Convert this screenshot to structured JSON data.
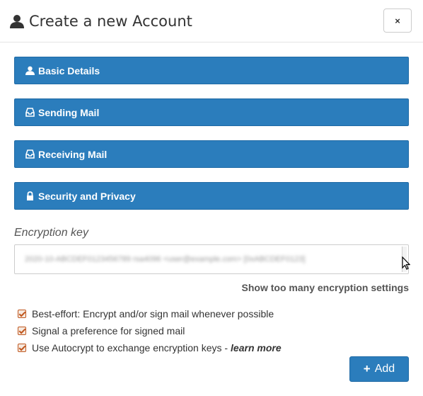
{
  "dialog": {
    "title": "Create a new Account",
    "close_label": "×"
  },
  "panels": [
    {
      "label": "Basic Details",
      "icon": "user-icon"
    },
    {
      "label": "Sending Mail",
      "icon": "inbox-icon"
    },
    {
      "label": "Receiving Mail",
      "icon": "inbox-icon"
    },
    {
      "label": "Security and Privacy",
      "icon": "lock-icon"
    }
  ],
  "encryption": {
    "label": "Encryption key",
    "value": "2020-10-ABCDEF0123456789 rsa4096 <user@example.com> [0xABCDEF0123]",
    "show_more": "Show too many encryption settings"
  },
  "options": [
    {
      "label": "Best-effort: Encrypt and/or sign mail whenever possible",
      "checked": true
    },
    {
      "label": "Signal a preference for signed mail",
      "checked": true
    },
    {
      "label": "Use Autocrypt to exchange encryption keys -",
      "checked": true,
      "link": "learn more"
    }
  ],
  "actions": {
    "add_label": "Add"
  },
  "colors": {
    "primary": "#2b7dbc",
    "checkbox": "#c0571f"
  }
}
